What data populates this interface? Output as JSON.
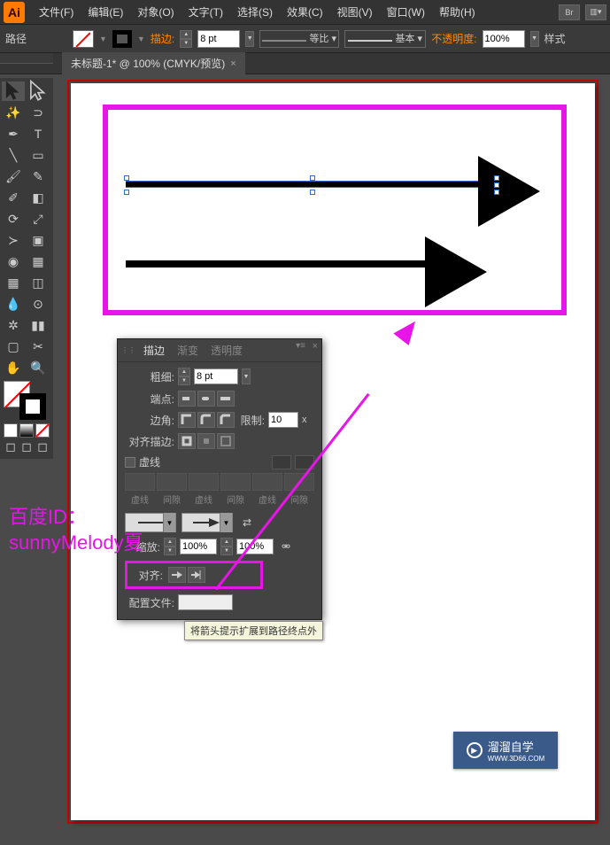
{
  "app": {
    "icon_text": "Ai"
  },
  "menu": {
    "file": "文件(F)",
    "edit": "编辑(E)",
    "object": "对象(O)",
    "type": "文字(T)",
    "select": "选择(S)",
    "effect": "效果(C)",
    "view": "视图(V)",
    "window": "窗口(W)",
    "help": "帮助(H)",
    "br": "Br"
  },
  "controlbar": {
    "label_path": "路径",
    "stroke_label": "描边:",
    "stroke_weight": "8 pt",
    "uniform": "等比",
    "basic": "基本",
    "opacity_label": "不透明度:",
    "opacity_value": "100%",
    "style_label": "样式"
  },
  "tab": {
    "title": "未标题-1* @ 100% (CMYK/预览)",
    "close": "×"
  },
  "panel": {
    "tabs": {
      "stroke": "描边",
      "gradient": "渐变",
      "transparency": "透明度"
    },
    "weight_label": "粗细:",
    "weight_value": "8 pt",
    "cap_label": "端点:",
    "corner_label": "边角:",
    "limit_label": "限制:",
    "limit_value": "10",
    "limit_unit": "x",
    "align_stroke_label": "对齐描边:",
    "dashed_label": "虚线",
    "dash_lbls": [
      "虚线",
      "间隙",
      "虚线",
      "间隙",
      "虚线",
      "间隙"
    ],
    "scale_label": "缩放:",
    "scale_val_a": "100%",
    "scale_val_b": "100%",
    "align_label": "对齐:",
    "profile_label": "配置文件:"
  },
  "tooltip": {
    "text": "将箭头提示扩展到路径终点外"
  },
  "watermark": {
    "line1": "百度ID：",
    "line2": "sunnyMelody夏"
  },
  "logo": {
    "brand": "溜溜自学",
    "url": "WWW.3D66.COM"
  }
}
